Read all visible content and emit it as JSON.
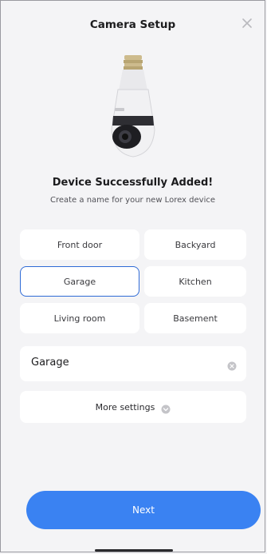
{
  "header": {
    "title": "Camera Setup",
    "close_icon": "close-icon"
  },
  "status": {
    "headline": "Device Successfully Added!",
    "subline": "Create a name for your new Lorex device"
  },
  "presets": [
    {
      "label": "Front door",
      "selected": false
    },
    {
      "label": "Backyard",
      "selected": false
    },
    {
      "label": "Garage",
      "selected": true
    },
    {
      "label": "Kitchen",
      "selected": false
    },
    {
      "label": "Living room",
      "selected": false
    },
    {
      "label": "Basement",
      "selected": false
    }
  ],
  "name_field": {
    "value": "Garage",
    "clear_icon": "clear-icon"
  },
  "more_settings": {
    "label": "More settings",
    "icon": "chevron-down-icon"
  },
  "next_button": {
    "label": "Next"
  },
  "colors": {
    "accent": "#3a82f2",
    "selected_border": "#2f6bd6",
    "background": "#f4f4f6"
  }
}
